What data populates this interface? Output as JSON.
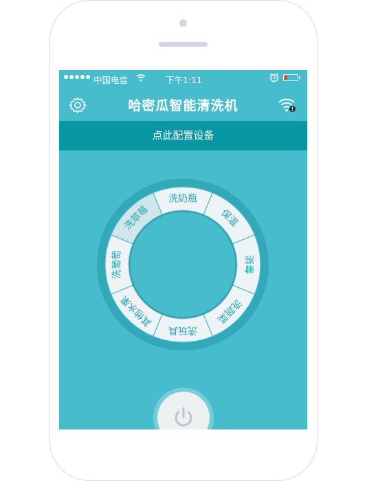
{
  "status_bar": {
    "carrier": "中国电信",
    "time": "下午1:11"
  },
  "nav": {
    "title": "哈密瓜智能清洗机"
  },
  "config_bar": {
    "label": "点此配置设备"
  },
  "modes": [
    {
      "label": "洗奶瓶"
    },
    {
      "label": "保温"
    },
    {
      "label": "消毒"
    },
    {
      "label": "洗蔬菜"
    },
    {
      "label": "洗玩具"
    },
    {
      "label": "其他水果"
    },
    {
      "label": "洗葡萄"
    },
    {
      "label": "洗草莓"
    }
  ],
  "colors": {
    "background": "#46bccc",
    "config_bar": "#0997a3",
    "dial_segment": "#eef4f5",
    "dial_selected": "#cfe7e9",
    "segment_text": "#2aa4b3"
  },
  "icons": {
    "settings": "gear-icon",
    "wifi": "wifi-alert-icon",
    "power": "power-icon"
  }
}
